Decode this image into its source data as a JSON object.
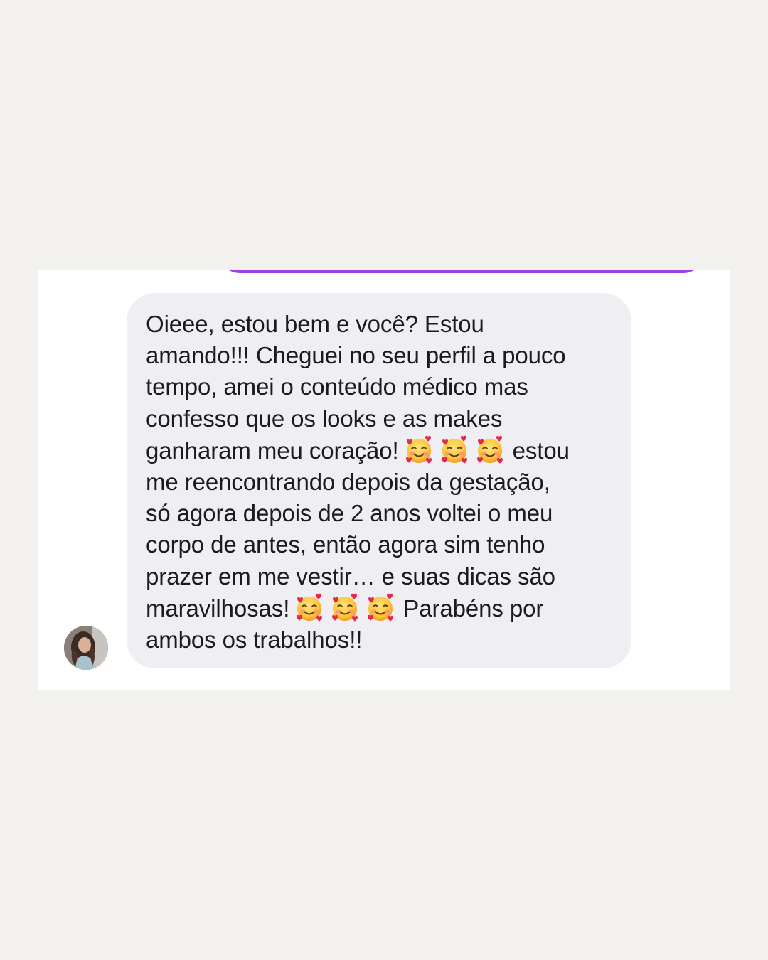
{
  "conversation": {
    "message": {
      "sender": "received",
      "lines": [
        "Oieee, estou bem e você? Estou",
        "amando!!! Cheguei no seu perfil a pouco",
        "tempo, amei o conteúdo médico mas",
        "confesso que os looks e as makes",
        {
          "before": "ganharam meu coração!",
          "emoji_count": 3,
          "after": "estou"
        },
        "me reencontrando depois da gestação,",
        "só agora depois de 2 anos voltei o meu",
        "corpo de antes, então agora sim tenho",
        "prazer em me vestir… e suas dicas são",
        {
          "before": "maravilhosas!",
          "emoji_count": 3,
          "after": "Parabéns por"
        },
        "ambos os trabalhos!!"
      ],
      "emoji": "🥰",
      "emoji_name": "smiling-face-with-hearts-icon"
    },
    "sent_bubble_color": "#9a44e0",
    "received_bubble_color": "#efeff3"
  }
}
